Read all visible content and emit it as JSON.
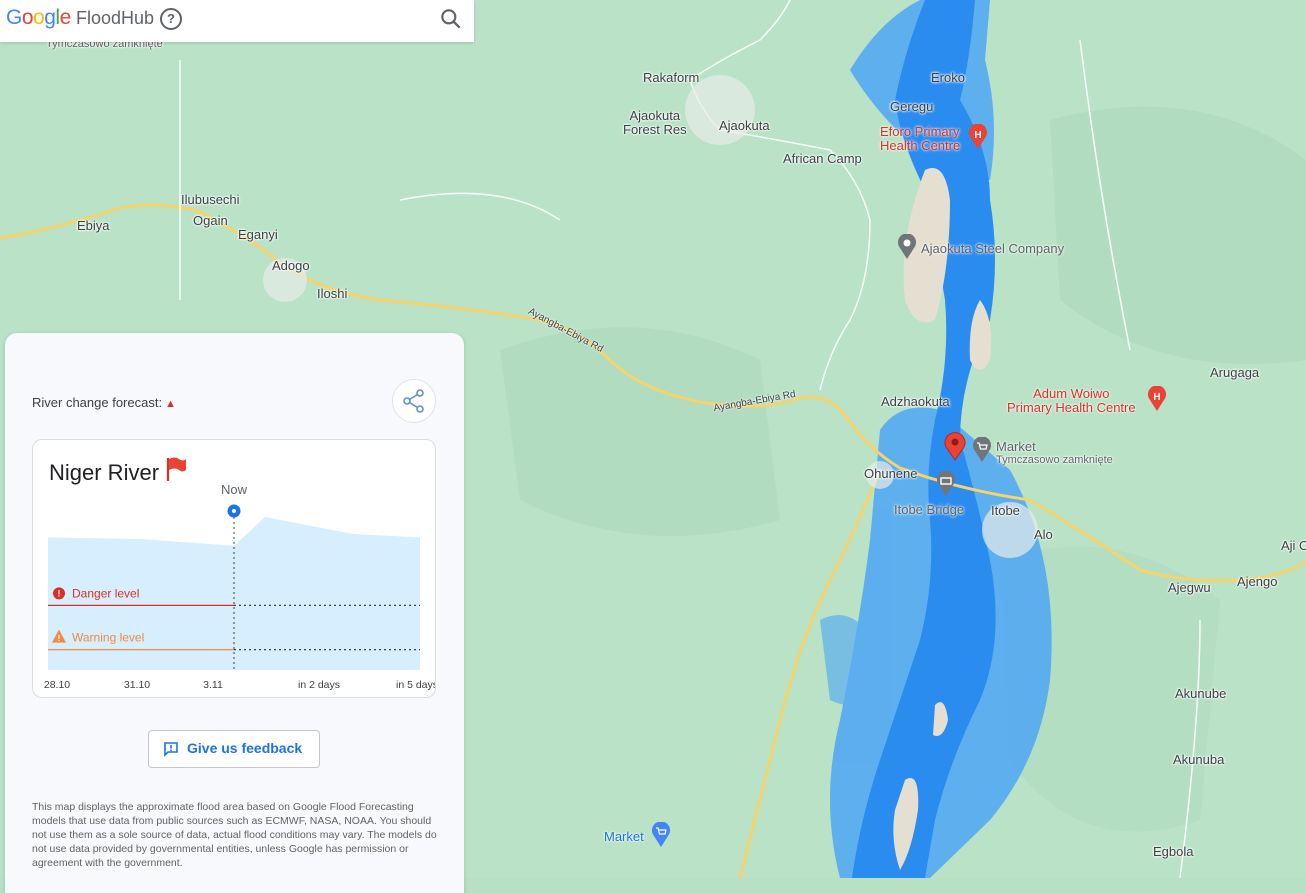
{
  "header": {
    "logo_letters": [
      "G",
      "o",
      "o",
      "g",
      "l",
      "e"
    ],
    "product_name": "FloodHub",
    "help_symbol": "?",
    "search_icon": "search-icon"
  },
  "map": {
    "places": {
      "rakaform": "Rakaform",
      "ajaokuta_forest_1": "Ajaokuta",
      "ajaokuta_forest_2": "Forest Res",
      "ajaokuta": "Ajaokuta",
      "african_camp": "African Camp",
      "eroko": "Eroko",
      "geregu": "Geregu",
      "ilubusechi": "Ilubusechi",
      "ogain": "Ogain",
      "eganyi": "Eganyi",
      "ebiya": "Ebiya",
      "adogo": "Adogo",
      "iloshi": "Iloshi",
      "adzhaokuta": "Adzhaokuta",
      "ohunene": "Ohunene",
      "itobe": "Itobe",
      "alo": "Alo",
      "ajegwu": "Ajegwu",
      "ajengo": "Ajengo",
      "aji": "Aji O",
      "arugaga": "Arugaga",
      "akunube": "Akunube",
      "akunuba": "Akunuba",
      "egbola": "Egbola"
    },
    "top_closed": "Tymczasowo zamknięte",
    "pois": {
      "eforo_1": "Eforo Primary",
      "eforo_2": "Health Centre",
      "steel": "Ajaokuta Steel Company",
      "adum_1": "Adum Woiwo",
      "adum_2": "Primary Health Centre",
      "market": "Market",
      "market_status": "Tymczasowo zamknięte",
      "bridge": "Itobe Bridge",
      "market2": "Market"
    },
    "roads": {
      "road1": "Ayangba-Ebiya Rd",
      "road2": "Ayangba-Ebiya Rd"
    },
    "colors": {
      "land": "#b7e0c4",
      "water": "#2b8cf0",
      "flood": "#4da6f5",
      "road": "#f6d36b"
    }
  },
  "panel": {
    "forecast_label": "River change forecast:",
    "forecast_trend_icon": "arrow-up-icon",
    "share_icon": "share-icon",
    "river_name": "Niger River",
    "river_status_icon": "red-flag-icon",
    "feedback_label": "Give us feedback",
    "disclaimer": "This map displays the approximate flood area based on Google Flood Forecasting models that use data from public sources such as ECMWF, NASA, NOAA. You should not use them as a sole source of data, actual flood conditions may vary. The models do not use data provided by governmental entities, unless Google has permission or agreement with the government."
  },
  "chart_data": {
    "type": "area",
    "now_label": "Now",
    "x_tick_labels": [
      "28.10",
      "31.10",
      "3.11",
      "in 2 days",
      "in 5 days"
    ],
    "thresholds": [
      {
        "name": "Danger level",
        "color": "#d93025",
        "icon": "error-icon"
      },
      {
        "name": "Warning level",
        "color": "#f28b3c",
        "icon": "warning-icon"
      }
    ],
    "series_levels": [
      0.78,
      0.77,
      0.73,
      0.9,
      0.8,
      0.78
    ],
    "threshold_levels": {
      "danger": 0.38,
      "warning": 0.12
    },
    "fill_color": "#d6eefd"
  }
}
